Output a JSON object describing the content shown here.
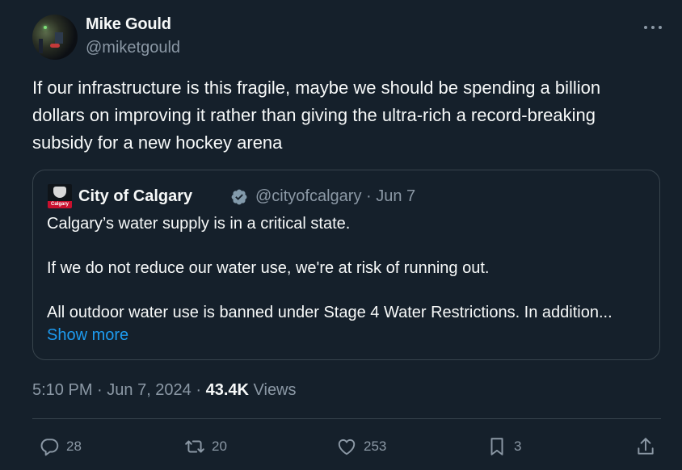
{
  "author": {
    "name": "Mike Gould",
    "handle": "@miketgould"
  },
  "tweet": {
    "text": "If our infrastructure is this fragile, maybe we should be spending a billion\ndollars on improving it rather than giving the ultra-rich a record-breaking\nsubsidy for a new hockey arena"
  },
  "quoted": {
    "logo_text": "Calgary",
    "name": "City of Calgary",
    "handle": "@cityofcalgary",
    "date": "Jun 7",
    "lines": [
      "Calgary’s water supply is in a critical state.",
      "If we do not reduce our water use, we're at risk of running out.",
      "All outdoor water use is banned under Stage 4 Water Restrictions. In addition..."
    ],
    "show_more": "Show more"
  },
  "meta": {
    "time": "5:10 PM",
    "date": "Jun 7, 2024",
    "views_count": "43.4K",
    "views_label": "Views"
  },
  "actions": {
    "replies": "28",
    "reposts": "20",
    "likes": "253",
    "bookmarks": "3"
  },
  "colors": {
    "background": "#15202b",
    "accent": "#1d9bf0",
    "muted": "#8b98a5",
    "border": "#38444d"
  }
}
